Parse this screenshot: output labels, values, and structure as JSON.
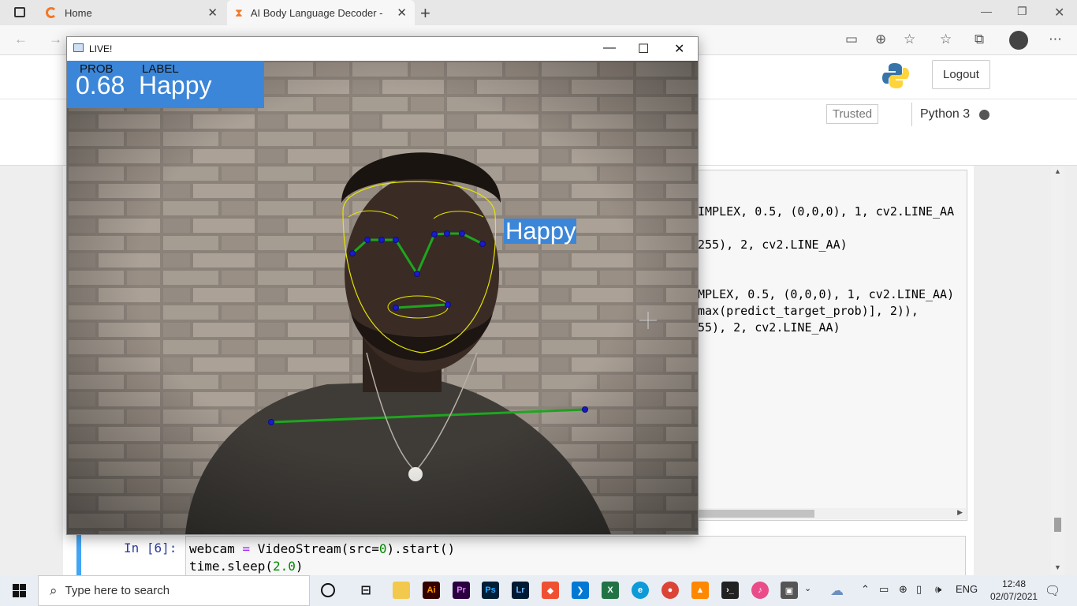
{
  "browser": {
    "tabs": [
      {
        "label": "Home"
      },
      {
        "label": "AI Body Language Decoder - Jup"
      }
    ]
  },
  "jupyter": {
    "logout_label": "Logout",
    "trusted_label": "Trusted",
    "kernel_label": "Python 3"
  },
  "code_cell_visible": {
    "lines": [
      "IMPLEX, 0.5, (0,0,0), 1, cv2.LINE_AA",
      "255), 2, cv2.LINE_AA)",
      "MPLEX, 0.5, (0,0,0), 1, cv2.LINE_AA)",
      "max(predict_target_prob)], 2)),",
      "55), 2, cv2.LINE_AA)"
    ]
  },
  "cell_6": {
    "prompt": "In [6]:",
    "line1": {
      "var": "webcam",
      "op": " = ",
      "rest1": "VideoStream(src=",
      "num": "0",
      "rest2": ").start()"
    },
    "line2": {
      "pre": "time.sleep(",
      "num": "2.0",
      "post": ")"
    }
  },
  "live_window": {
    "title": "LIVE!",
    "overlay": {
      "prob_header": "PROB",
      "label_header": "LABEL",
      "prob_value": "0.68",
      "label_value": "Happy",
      "face_tag": "Happy"
    },
    "colors": {
      "overlay_blue": "#3b86d8",
      "landmark_green": "#1fa51f",
      "face_mesh_yellow": "#e6e600"
    }
  },
  "taskbar": {
    "search_placeholder": "Type here to search",
    "language": "ENG",
    "time": "12:48",
    "date": "02/07/2021",
    "pinned_icons": [
      "task-view-icon",
      "file-explorer-icon",
      "illustrator-icon",
      "premiere-icon",
      "photoshop-icon",
      "lightroom-icon",
      "git-icon",
      "vscode-icon",
      "excel-icon",
      "edge-icon",
      "chrome-icon",
      "vlc-icon",
      "terminal-icon",
      "itunes-icon",
      "camera-icon"
    ]
  }
}
